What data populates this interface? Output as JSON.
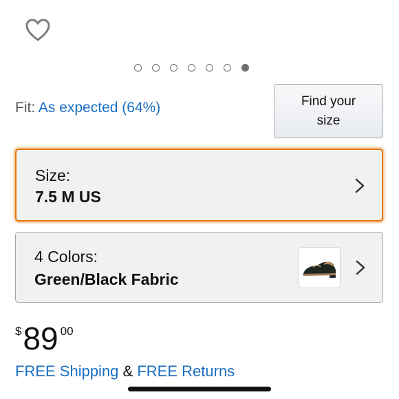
{
  "wishlist": {
    "icon": "heart-outline-icon"
  },
  "carousel": {
    "count": 7,
    "active_index": 6
  },
  "fit": {
    "label": "Fit:",
    "value": "As expected (64%)"
  },
  "find_size_button": {
    "label": "Find your size"
  },
  "size_selector": {
    "label": "Size:",
    "value": "7.5 M US",
    "icon": "chevron-right-icon"
  },
  "color_selector": {
    "label": "4 Colors:",
    "value": "Green/Black Fabric",
    "thumbnail": "loafer-shoe-thumbnail",
    "icon": "chevron-right-icon"
  },
  "price": {
    "currency_symbol": "$",
    "whole": "89",
    "fraction": "00"
  },
  "shipping": {
    "free_shipping": "FREE Shipping",
    "connector": "&",
    "free_returns": "FREE Returns"
  },
  "colors": {
    "link": "#1a6ec2",
    "focus_border": "#e77600",
    "selector_bg": "#f0f2f2"
  }
}
